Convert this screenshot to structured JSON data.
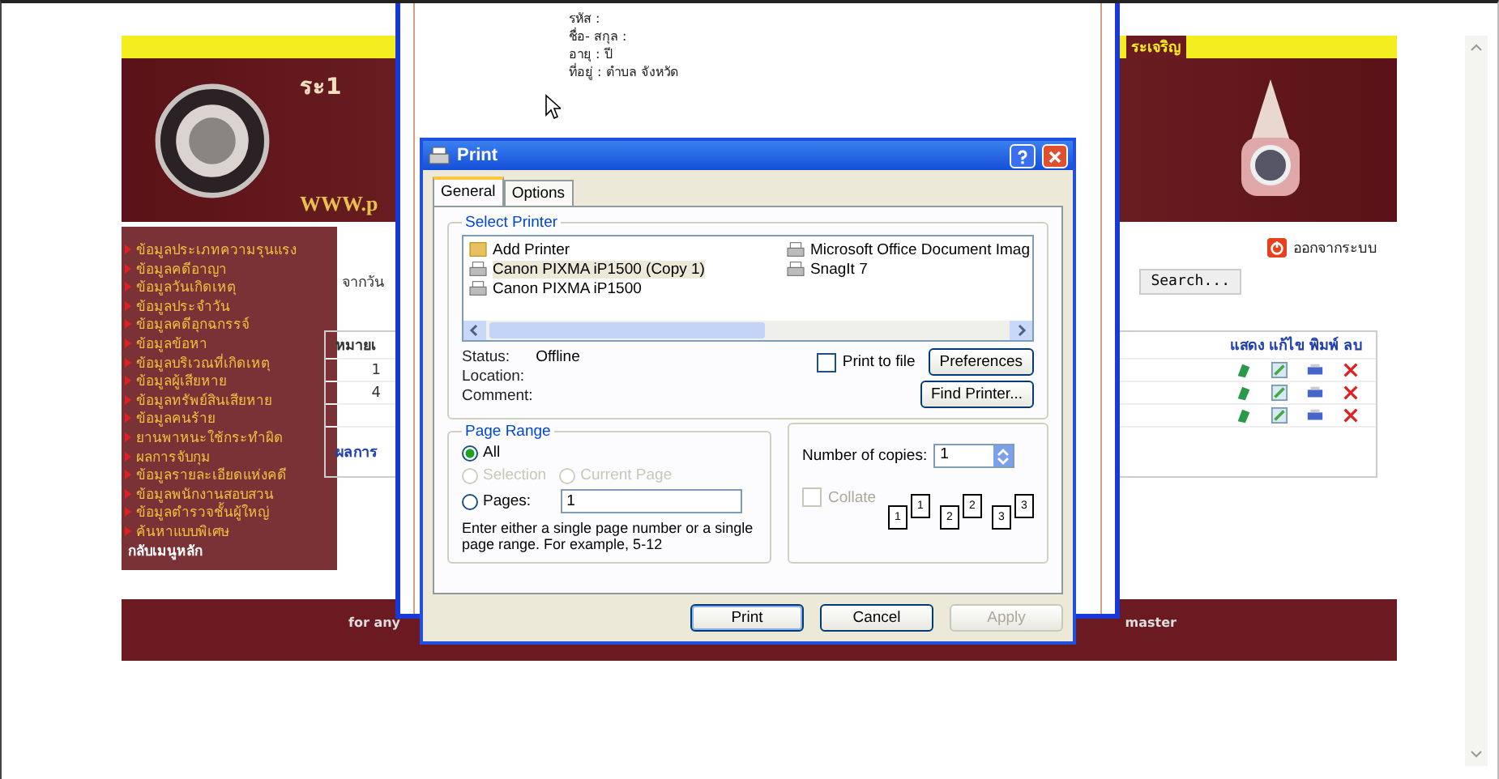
{
  "banner": {
    "left_text": "ระ1",
    "logo_text": "WWW.p",
    "right_text": "ระเจริญ"
  },
  "sidebar": {
    "items": [
      {
        "label": "ข้อมูลประเภทความรุนแรง",
        "kind": "item"
      },
      {
        "label": "ข้อมูลคดีอาญา",
        "kind": "item"
      },
      {
        "label": "ข้อมูลวันเกิดเหตุ",
        "kind": "item"
      },
      {
        "label": "ข้อมูลประจำวัน",
        "kind": "item"
      },
      {
        "label": "ข้อมูลคดีอุกฉกรรจ์",
        "kind": "item"
      },
      {
        "label": "ข้อมูลข้อหา",
        "kind": "item"
      },
      {
        "label": "ข้อมูลบริเวณที่เกิดเหตุ",
        "kind": "item"
      },
      {
        "label": "ข้อมูลผู้เสียหาย",
        "kind": "item"
      },
      {
        "label": "ข้อมูลทรัพย์สินเสียหาย",
        "kind": "item"
      },
      {
        "label": "ข้อมูลคนร้าย",
        "kind": "item"
      },
      {
        "label": "ยานพาหนะใช้กระทำผิด",
        "kind": "item"
      },
      {
        "label": "ผลการจับกุม",
        "kind": "item"
      },
      {
        "label": "ข้อมูลรายละเอียดแห่งคดี",
        "kind": "item"
      },
      {
        "label": "ข้อมูลพนักงานสอบสวน",
        "kind": "item"
      },
      {
        "label": "ข้อมูลตำรวจชั้นผู้ใหญ่",
        "kind": "item"
      },
      {
        "label": "ค้นหาแบบพิเศษ",
        "kind": "item"
      },
      {
        "label": "กลับเมนูหลัก",
        "kind": "main"
      }
    ]
  },
  "content": {
    "logout": "ออกจากระบบ",
    "date_label": "จากวัน",
    "search_button": "Search...",
    "table": {
      "column_1": "หมายเ",
      "actions": [
        "แสดง",
        "แก้ไข",
        "พิมพ์",
        "ลบ"
      ],
      "rows": [
        {
          "number": "1"
        },
        {
          "number": "4"
        },
        {}
      ]
    },
    "result_label": "ผลการ"
  },
  "footer": {
    "left": "for any",
    "right": "master"
  },
  "preview": {
    "lines": [
      "รหัส :",
      "ชื่อ- สกุล :",
      "อายุ : ปี",
      "ที่อยู่ : ตำบล จังหวัด"
    ]
  },
  "print_dialog": {
    "title": "Print",
    "tabs": [
      {
        "label": "General",
        "selected": true
      },
      {
        "label": "Options",
        "selected": false
      }
    ],
    "select_printer": {
      "legend": "Select Printer",
      "printers": [
        {
          "name": "Add Printer",
          "kind": "add",
          "selected": false
        },
        {
          "name": "Canon PIXMA iP1500 (Copy 1)",
          "kind": "printer",
          "selected": true
        },
        {
          "name": "Canon PIXMA iP1500",
          "kind": "printer",
          "selected": false
        },
        {
          "name": "Microsoft Office Document Imag",
          "kind": "printer",
          "selected": false
        },
        {
          "name": "SnagIt 7",
          "kind": "printer",
          "selected": false
        }
      ],
      "status_label": "Status:",
      "status_value": "Offline",
      "location_label": "Location:",
      "comment_label": "Comment:",
      "print_to_file": {
        "label": "Print to file",
        "checked": false
      },
      "preferences_button": "Preferences",
      "find_printer_button": "Find Printer..."
    },
    "page_range": {
      "legend": "Page Range",
      "options": [
        {
          "label": "All",
          "selected": true,
          "disabled": false
        },
        {
          "label": "Selection",
          "selected": false,
          "disabled": true
        },
        {
          "label": "Current Page",
          "selected": false,
          "disabled": true
        },
        {
          "label": "Pages:",
          "selected": false,
          "disabled": false
        }
      ],
      "pages_value": "1",
      "hint": "Enter either a single page number or a single page range.  For example, 5-12"
    },
    "copies": {
      "label": "Number of copies:",
      "value": "1",
      "collate": {
        "label": "Collate",
        "checked": false,
        "disabled": true
      },
      "pages": [
        {
          "back": "1",
          "front": "1"
        },
        {
          "back": "2",
          "front": "2"
        },
        {
          "back": "3",
          "front": "3"
        }
      ]
    },
    "buttons": [
      {
        "label": "Print",
        "disabled": false
      },
      {
        "label": "Cancel",
        "disabled": false
      },
      {
        "label": "Apply",
        "disabled": true
      }
    ]
  }
}
